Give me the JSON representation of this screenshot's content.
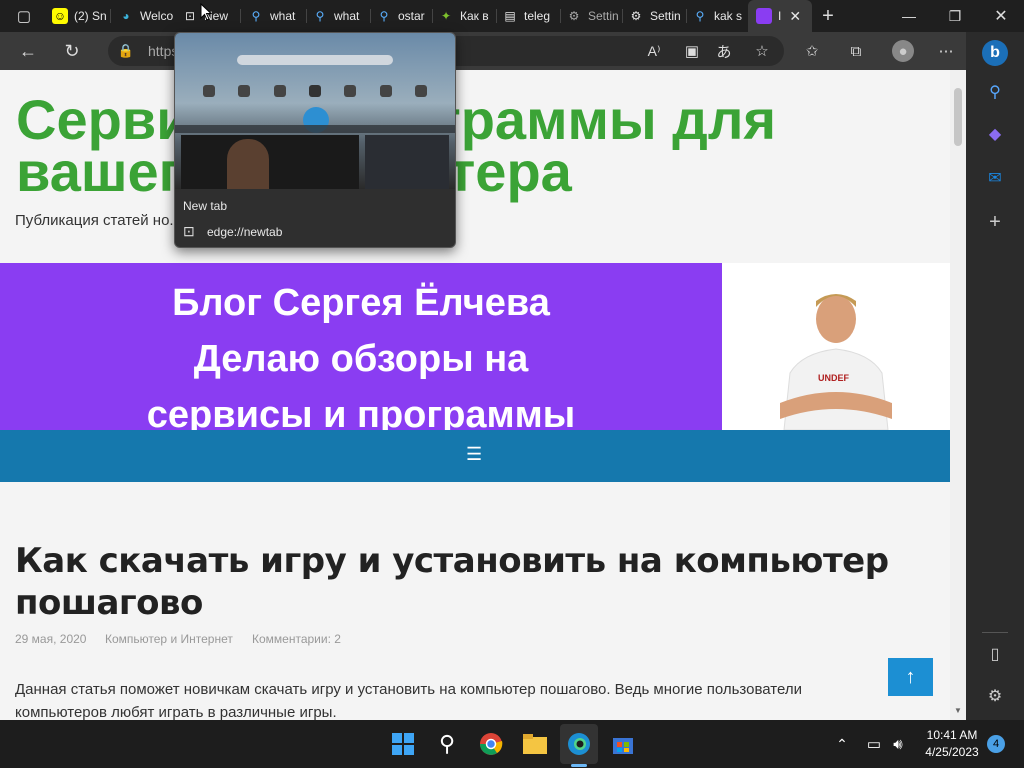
{
  "tabs": [
    {
      "label": "(2) Sn",
      "icon": "snapchat-icon"
    },
    {
      "label": "Welco",
      "icon": "edge-icon"
    },
    {
      "label": "New",
      "icon": "newtab-icon"
    },
    {
      "label": "what",
      "icon": "search-icon"
    },
    {
      "label": "what",
      "icon": "search-icon"
    },
    {
      "label": "ostar",
      "icon": "search-icon"
    },
    {
      "label": "Как в",
      "icon": "android-icon"
    },
    {
      "label": "teleg",
      "icon": "page-icon"
    },
    {
      "label": "Settin",
      "icon": "gear-icon"
    },
    {
      "label": "Settin",
      "icon": "gear-icon"
    },
    {
      "label": "kak s",
      "icon": "search-icon"
    },
    {
      "label": "I",
      "icon": "site-icon"
    }
  ],
  "address": {
    "url": "https://...ru-i-ustanovit-na-kompyute..."
  },
  "tooltip": {
    "title": "New tab",
    "url": "edge://newtab"
  },
  "site": {
    "title": "Сервисы и программы для вашего компьютера",
    "description": "Публикация статей но..."
  },
  "banner": {
    "line1": "Блог Сергея Ёлчева",
    "line2": "Делаю обзоры на",
    "line3": "сервисы и программы"
  },
  "nav": {
    "menu_icon": "☰"
  },
  "article": {
    "title": "Как скачать игру и установить на компьютер пошагово",
    "date": "29 мая, 2020",
    "category": "Компьютер и Интернет",
    "comments": "Комментарии: 2",
    "text": "Данная статья поможет новичкам скачать игру и установить на компьютер пошагово. Ведь многие пользователи компьютеров любят играть в различные игры."
  },
  "taskbar": {
    "time": "10:41 AM",
    "date": "4/25/2023",
    "notifications": "4"
  },
  "colors": {
    "title_green": "#3ba336",
    "banner_purple": "#8a3df2",
    "nav_blue": "#1578ad"
  }
}
